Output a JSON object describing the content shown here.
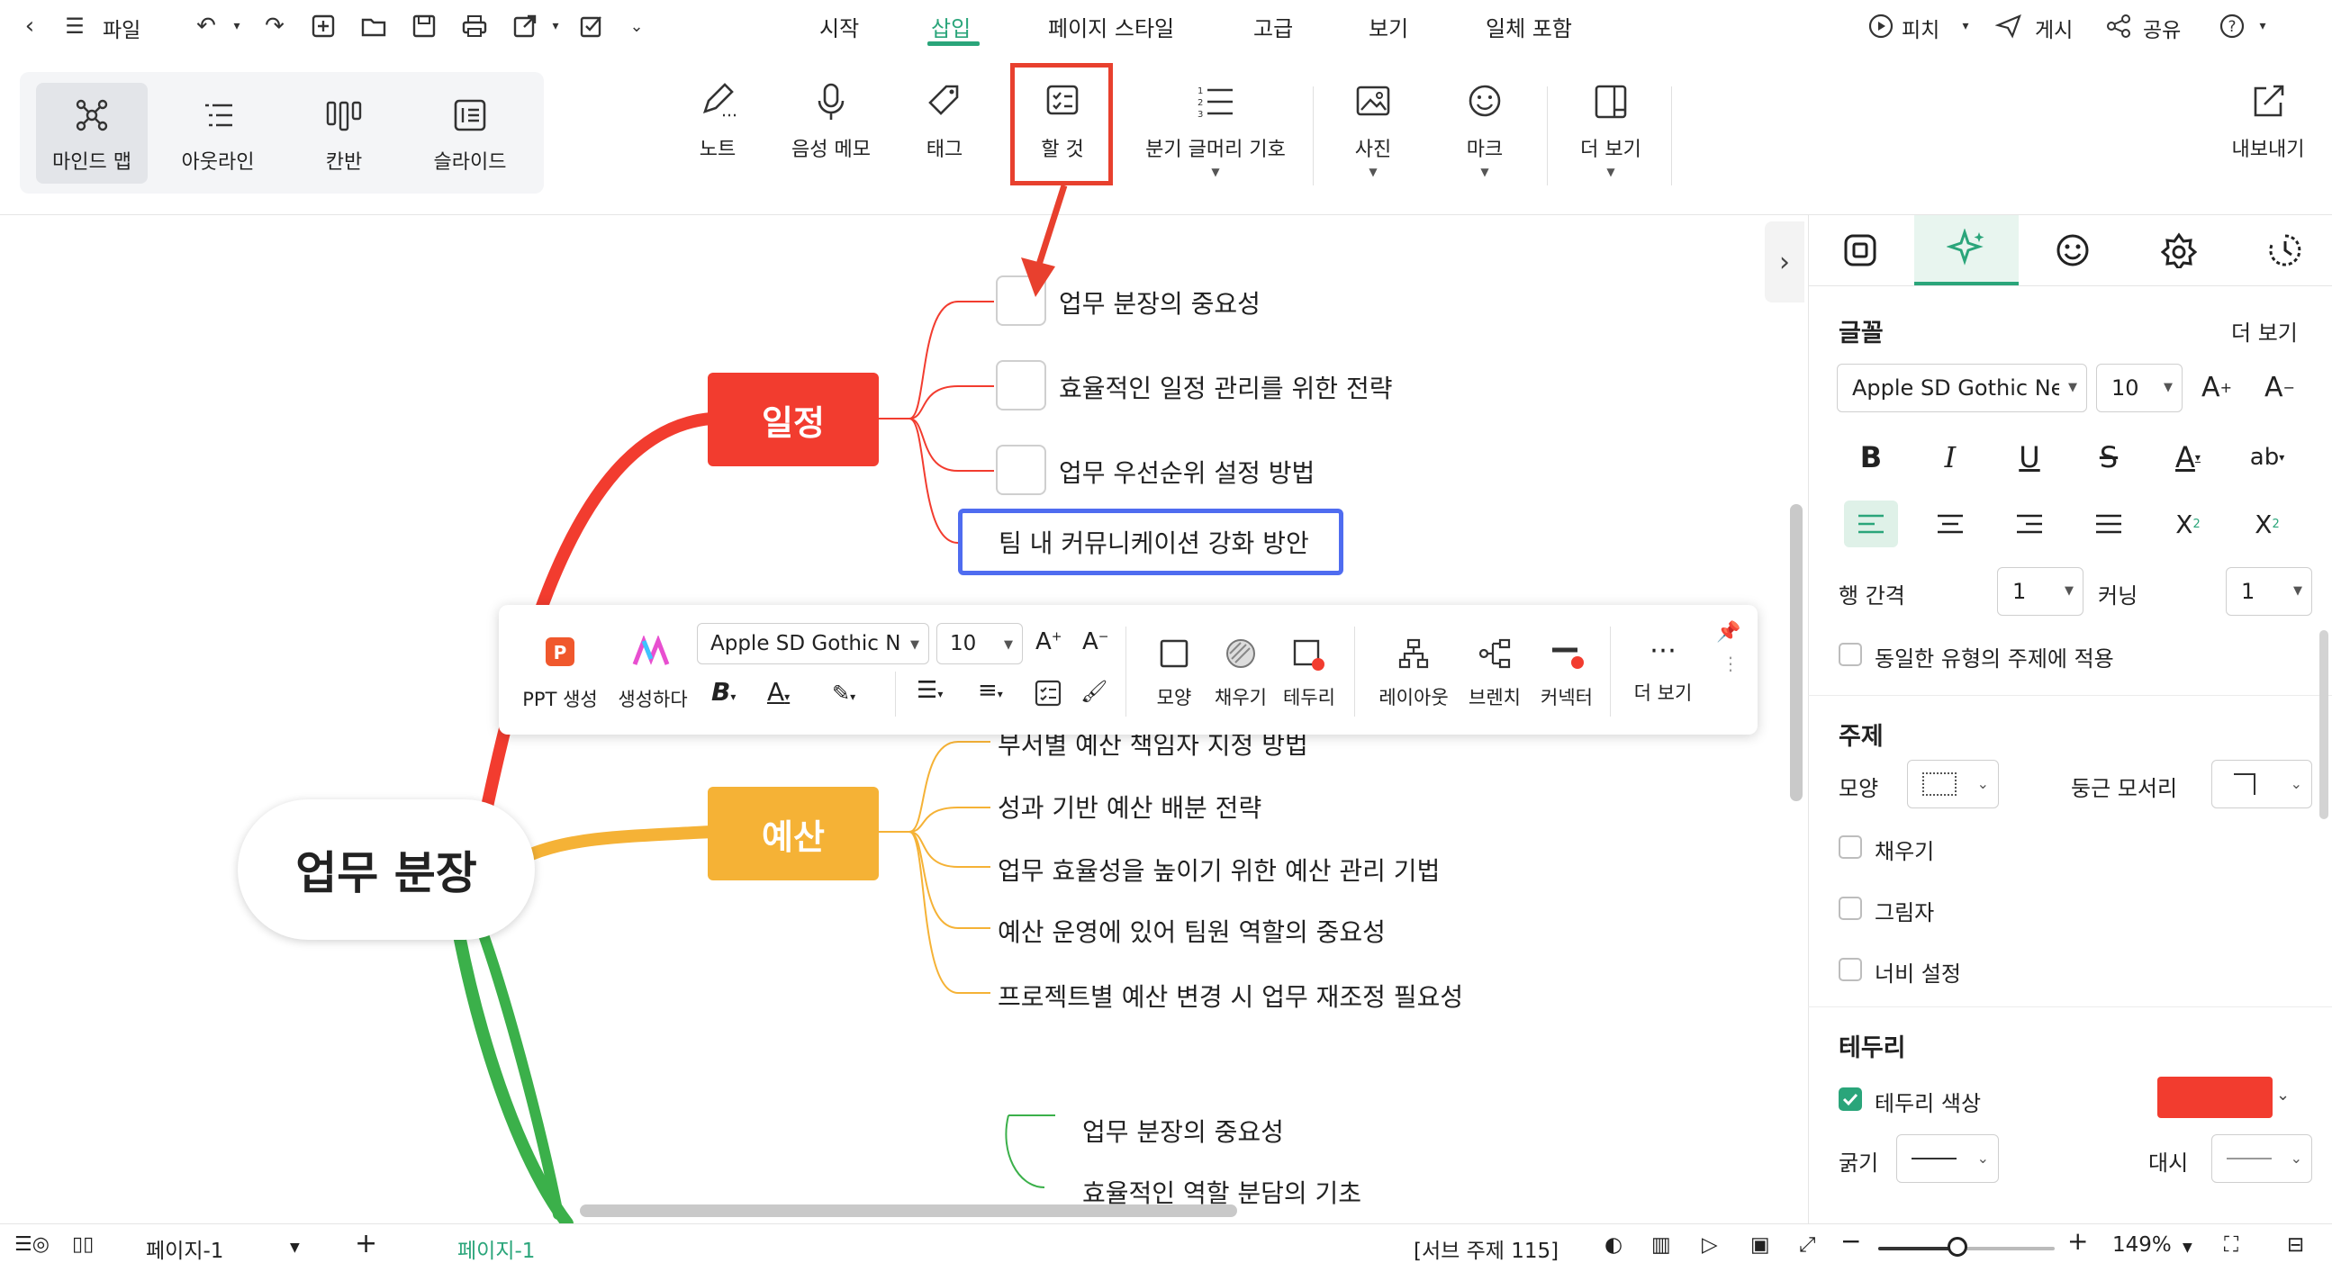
{
  "titlebar": {
    "file_label": "파일",
    "menu_tabs": [
      "시작",
      "삽입",
      "페이지 스타일",
      "고급",
      "보기",
      "일체 포함"
    ],
    "active_tab": "삽입",
    "pitch_label": "피치",
    "publish_label": "게시",
    "share_label": "공유"
  },
  "ribbon": {
    "views": [
      "마인드 맵",
      "아웃라인",
      "칸반",
      "슬라이드"
    ],
    "tools": [
      "노트",
      "음성 메모",
      "태그",
      "할 것",
      "분기 글머리 기호",
      "사진",
      "마크",
      "더 보기"
    ],
    "export_label": "내보내기",
    "highlight_color": "#e8402e"
  },
  "mindmap": {
    "central": "업무 분장",
    "topic1": {
      "label": "일정",
      "color": "#f23c2f",
      "subtopics": [
        "업무 분장의 중요성",
        "효율적인 일정 관리를 위한 전략",
        "업무 우선순위 설정 방법",
        "팀 내 커뮤니케이션 강화 방안"
      ]
    },
    "topic2": {
      "label": "예산",
      "color": "#f5b236",
      "subtopics": [
        "부서별 예산 책임자 지정 방법",
        "성과 기반 예산 배분 전략",
        "업무 효율성을 높이기 위한 예산 관리 기법",
        "예산 운영에 있어 팀원 역할의 중요성",
        "프로젝트별 예산 변경 시 업무 재조정 필요성"
      ]
    },
    "topic3": {
      "color": "#3bb04a",
      "subtopics": [
        "업무 분장의 중요성",
        "효율적인 역할 분담의 기초"
      ]
    }
  },
  "floating_toolbar": {
    "ppt_label": "PPT 생성",
    "generate_label": "생성하다",
    "font_name": "Apple SD Gothic N",
    "font_size": "10",
    "items": [
      "모양",
      "채우기",
      "테두리",
      "레이아웃",
      "브렌치",
      "커넥터",
      "더 보기"
    ]
  },
  "panel": {
    "font_heading": "글꼴",
    "more_label": "더 보기",
    "font_name": "Apple SD Gothic Ne",
    "font_size": "10",
    "line_spacing_label": "행 간격",
    "line_spacing_value": "1",
    "kerning_label": "커닝",
    "kerning_value": "1",
    "apply_same_label": "동일한 유형의 주제에 적용",
    "topic_heading": "주제",
    "shape_label": "모양",
    "corner_label": "둥근 모서리",
    "fill_label": "채우기",
    "shadow_label": "그림자",
    "width_label": "너비 설정",
    "border_heading": "테두리",
    "border_color_label": "테두리 색상",
    "border_color": "#f23c2f",
    "thickness_label": "굵기",
    "dash_label": "대시"
  },
  "statusbar": {
    "page_select": "페이지-1",
    "page_tab": "페이지-1",
    "subtopic_count": "[서브 주제 115]",
    "zoom": "149%",
    "zoom_fraction": 0.45
  }
}
